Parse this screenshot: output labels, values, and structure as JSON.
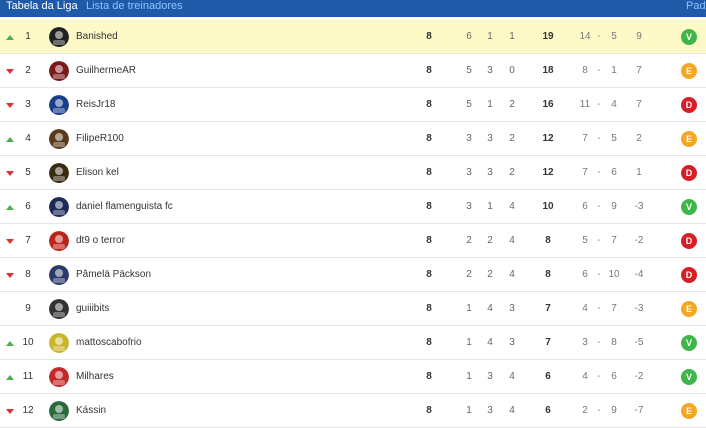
{
  "tabs": {
    "active": "Tabela da Liga",
    "second": "Lista de treinadores",
    "third": "Pad"
  },
  "colors": {
    "V": "#3fb54a",
    "E": "#f5a623",
    "D": "#d61f26"
  },
  "rows": [
    {
      "trend": "up",
      "pos": "1",
      "name": "Banished",
      "games": "8",
      "w": "6",
      "d": "1",
      "l": "1",
      "pts": "19",
      "gf": "14",
      "ga": "5",
      "gd": "9",
      "last": "V",
      "icon": "banished-avatar-icon"
    },
    {
      "trend": "down",
      "pos": "2",
      "name": "GuilhermeAR",
      "games": "8",
      "w": "5",
      "d": "3",
      "l": "0",
      "pts": "18",
      "gf": "8",
      "ga": "1",
      "gd": "7",
      "last": "E",
      "icon": "guilhermear-avatar-icon"
    },
    {
      "trend": "down",
      "pos": "3",
      "name": "ReisJr18",
      "games": "8",
      "w": "5",
      "d": "1",
      "l": "2",
      "pts": "16",
      "gf": "11",
      "ga": "4",
      "gd": "7",
      "last": "D",
      "icon": "reisjr18-avatar-icon"
    },
    {
      "trend": "up",
      "pos": "4",
      "name": "FilipeR100",
      "games": "8",
      "w": "3",
      "d": "3",
      "l": "2",
      "pts": "12",
      "gf": "7",
      "ga": "5",
      "gd": "2",
      "last": "E",
      "icon": "filiper100-avatar-icon"
    },
    {
      "trend": "down",
      "pos": "5",
      "name": "Elison kel",
      "games": "8",
      "w": "3",
      "d": "3",
      "l": "2",
      "pts": "12",
      "gf": "7",
      "ga": "6",
      "gd": "1",
      "last": "D",
      "icon": "elison-kel-avatar-icon"
    },
    {
      "trend": "up",
      "pos": "6",
      "name": "daniel flamenguista fc",
      "games": "8",
      "w": "3",
      "d": "1",
      "l": "4",
      "pts": "10",
      "gf": "6",
      "ga": "9",
      "gd": "-3",
      "last": "V",
      "icon": "daniel-avatar-icon"
    },
    {
      "trend": "down",
      "pos": "7",
      "name": "dt9 o terror",
      "games": "8",
      "w": "2",
      "d": "2",
      "l": "4",
      "pts": "8",
      "gf": "5",
      "ga": "7",
      "gd": "-2",
      "last": "D",
      "icon": "dt9-avatar-icon"
    },
    {
      "trend": "down",
      "pos": "8",
      "name": "Pâmelä Päckson",
      "games": "8",
      "w": "2",
      "d": "2",
      "l": "4",
      "pts": "8",
      "gf": "6",
      "ga": "10",
      "gd": "-4",
      "last": "D",
      "icon": "pamela-avatar-icon"
    },
    {
      "trend": "none",
      "pos": "9",
      "name": "guiiibits",
      "games": "8",
      "w": "1",
      "d": "4",
      "l": "3",
      "pts": "7",
      "gf": "4",
      "ga": "7",
      "gd": "-3",
      "last": "E",
      "icon": "guiiibits-avatar-icon"
    },
    {
      "trend": "up",
      "pos": "10",
      "name": "mattoscabofrio",
      "games": "8",
      "w": "1",
      "d": "4",
      "l": "3",
      "pts": "7",
      "gf": "3",
      "ga": "8",
      "gd": "-5",
      "last": "V",
      "icon": "mattoscabofrio-avatar-icon"
    },
    {
      "trend": "up",
      "pos": "11",
      "name": "Milhares",
      "games": "8",
      "w": "1",
      "d": "3",
      "l": "4",
      "pts": "6",
      "gf": "4",
      "ga": "6",
      "gd": "-2",
      "last": "V",
      "icon": "milhares-avatar-icon"
    },
    {
      "trend": "down",
      "pos": "12",
      "name": "Kássin",
      "games": "8",
      "w": "1",
      "d": "3",
      "l": "4",
      "pts": "6",
      "gf": "2",
      "ga": "9",
      "gd": "-7",
      "last": "E",
      "icon": "kassin-avatar-icon"
    }
  ]
}
